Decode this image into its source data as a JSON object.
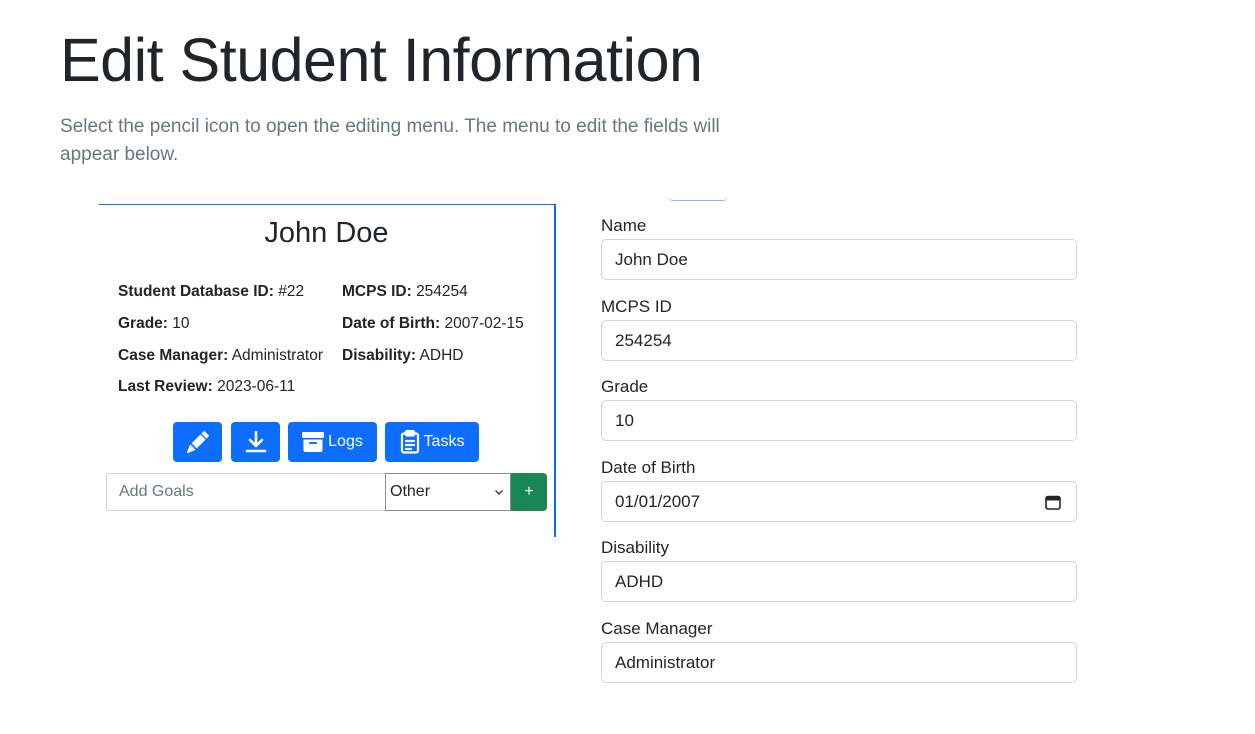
{
  "header": {
    "title": "Edit Student Information",
    "intro": "Select the pencil icon to open the editing menu. The menu to edit the fields will appear below."
  },
  "card": {
    "name": "John Doe",
    "info": {
      "db_id_label": "Student Database ID:",
      "db_id_value": "#22",
      "mcps_label": "MCPS ID:",
      "mcps_value": "254254",
      "grade_label": "Grade:",
      "grade_value": "10",
      "dob_label": "Date of Birth:",
      "dob_value": "2007-02-15",
      "cm_label": "Case Manager:",
      "cm_value": "Administrator",
      "dis_label": "Disability:",
      "dis_value": "ADHD",
      "review_label": "Last Review:",
      "review_value": "2023-06-11"
    },
    "buttons": {
      "edit_icon": "pencil-icon",
      "download_icon": "download-icon",
      "logs_label": "Logs",
      "logs_icon": "archive-icon",
      "tasks_label": "Tasks",
      "tasks_icon": "clipboard-icon"
    },
    "goals": {
      "placeholder": "Add Goals",
      "selected": "Other",
      "add_label": "+"
    }
  },
  "form": {
    "fields": [
      {
        "label": "Name",
        "value": "John Doe"
      },
      {
        "label": "MCPS ID",
        "value": "254254"
      },
      {
        "label": "Grade",
        "value": "10"
      },
      {
        "label": "Date of Birth",
        "value": "01/01/2007"
      },
      {
        "label": "Disability",
        "value": "ADHD"
      },
      {
        "label": "Case Manager",
        "value": "Administrator"
      }
    ]
  },
  "colors": {
    "primary": "#0d6efd",
    "success": "#198754",
    "muted": "#6c757d"
  }
}
